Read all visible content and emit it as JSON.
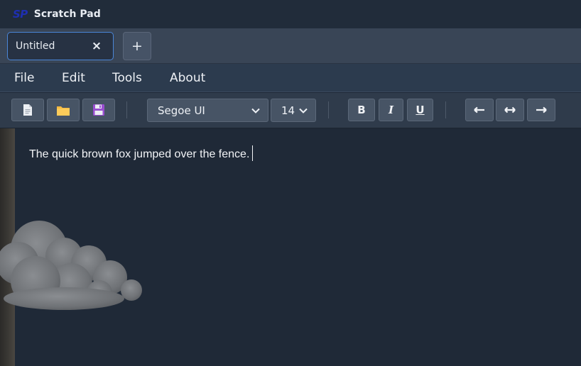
{
  "titlebar": {
    "logo": "SP",
    "title": "Scratch Pad"
  },
  "tabs": {
    "items": [
      {
        "label": "Untitled",
        "close": "×"
      }
    ],
    "new_tab": "+"
  },
  "menu": {
    "items": [
      {
        "label": "File"
      },
      {
        "label": "Edit"
      },
      {
        "label": "Tools"
      },
      {
        "label": "About"
      }
    ]
  },
  "toolbar": {
    "file_buttons": [
      {
        "icon": "new-file-icon"
      },
      {
        "icon": "open-folder-icon"
      },
      {
        "icon": "save-icon"
      }
    ],
    "font_family": "Segoe UI",
    "font_size": "14",
    "format": {
      "bold": "B",
      "italic": "I",
      "underline": "U"
    },
    "align_buttons": [
      {
        "icon": "align-left-icon"
      },
      {
        "icon": "align-center-icon"
      },
      {
        "icon": "align-right-icon"
      }
    ]
  },
  "editor": {
    "text": "The quick brown fox jumped over the fence."
  },
  "colors": {
    "accent": "#4a86d8",
    "background": "#1f2937",
    "logo": "#1e2fb0"
  }
}
